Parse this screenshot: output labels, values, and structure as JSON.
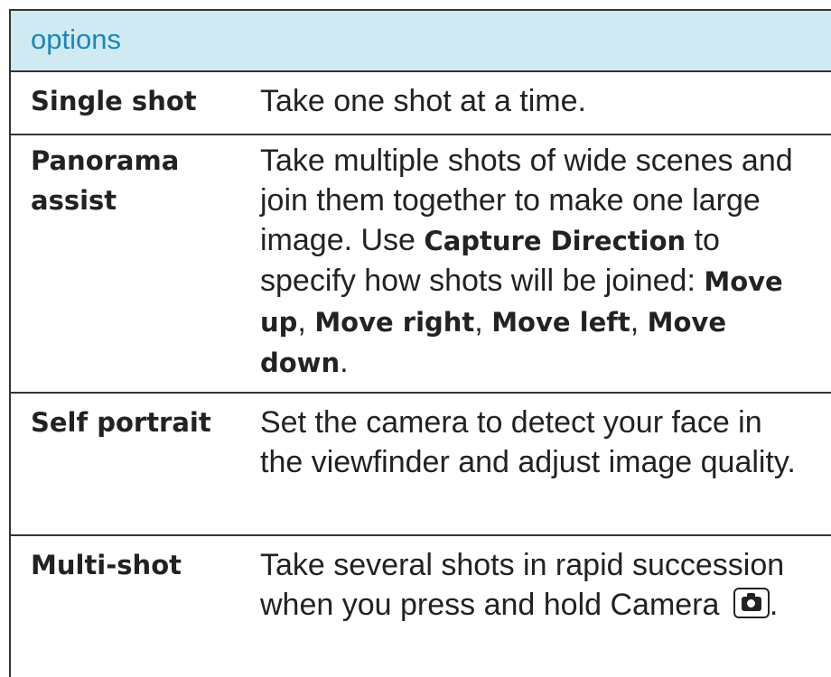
{
  "header": {
    "title": "options"
  },
  "rows": [
    {
      "option": "Single shot",
      "description": "Take one shot at a time."
    },
    {
      "option_line1": "Panorama",
      "option_line2": "assist",
      "desc_a": "Take multiple shots of wide scenes and join them together to make one large image. Use ",
      "bold_1": "Capture Direction",
      "desc_b": " to specify how shots will be joined: ",
      "bold_2": "Move up",
      "sep_1": ", ",
      "bold_3": "Move right",
      "sep_2": ", ",
      "bold_4": "Move left",
      "sep_3": ", ",
      "bold_5": "Move down",
      "end": "."
    },
    {
      "option": "Self portrait",
      "description": "Set the camera to detect your face in the viewfinder and adjust image quality."
    },
    {
      "option": "Multi-shot",
      "description": "Take several shots in rapid succession when you press and hold Camera ",
      "icon": "camera-key-icon",
      "end": "."
    }
  ]
}
